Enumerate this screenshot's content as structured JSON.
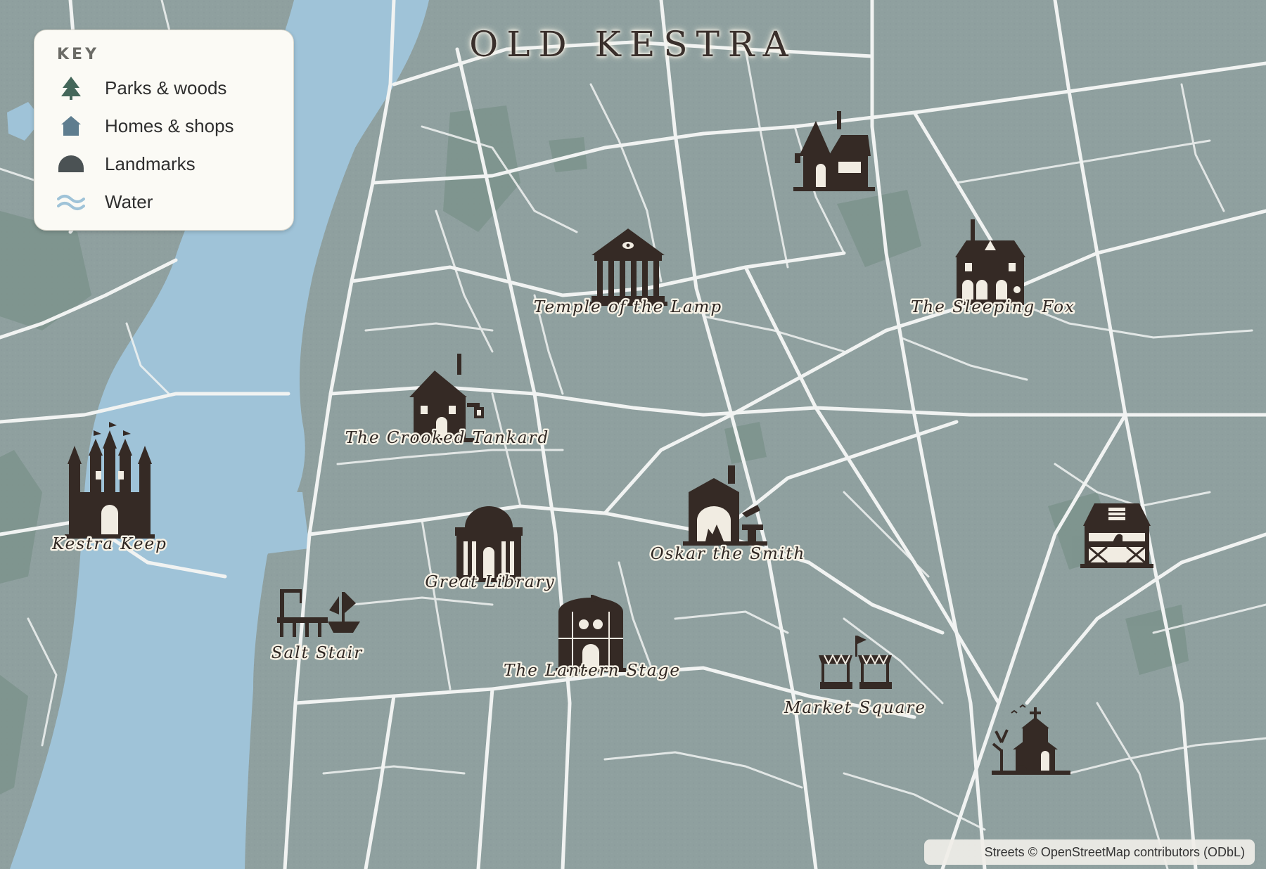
{
  "map_title": "OLD KESTRA",
  "key": {
    "title": "KEY",
    "items": [
      {
        "label": "Parks & woods",
        "icon": "tree-icon",
        "color": "#44675a"
      },
      {
        "label": "Homes & shops",
        "icon": "house-icon",
        "color": "#5e7d8f"
      },
      {
        "label": "Landmarks",
        "icon": "dome-icon",
        "color": "#4b5254"
      },
      {
        "label": "Water",
        "icon": "waves-icon",
        "color": "#9fc3d8"
      }
    ]
  },
  "landmarks": [
    {
      "name": "Temple of the Lamp",
      "icon": "temple-icon"
    },
    {
      "name": "The Sleeping Fox",
      "icon": "inn-icon"
    },
    {
      "name": "The Crooked Tankard",
      "icon": "tavern-icon"
    },
    {
      "name": "Kestra Keep",
      "icon": "castle-icon"
    },
    {
      "name": "Great Library",
      "icon": "library-icon"
    },
    {
      "name": "Oskar the Smith",
      "icon": "smithy-icon"
    },
    {
      "name": "Salt Stair",
      "icon": "dock-icon"
    },
    {
      "name": "The Lantern Stage",
      "icon": "theatre-icon"
    },
    {
      "name": "Market Square",
      "icon": "market-icon"
    }
  ],
  "unlabeled_icons": [
    "townhouse-icon",
    "stable-icon",
    "chapel-icon"
  ],
  "attribution": "Streets © OpenStreetMap contributors (ODbL)",
  "colors": {
    "land": "#8fa09f",
    "water": "#9fc3d8",
    "park": "#7d938d",
    "street": "#f1f3f2",
    "icon": "#352a25",
    "label_halo": "#f7f2e6"
  }
}
